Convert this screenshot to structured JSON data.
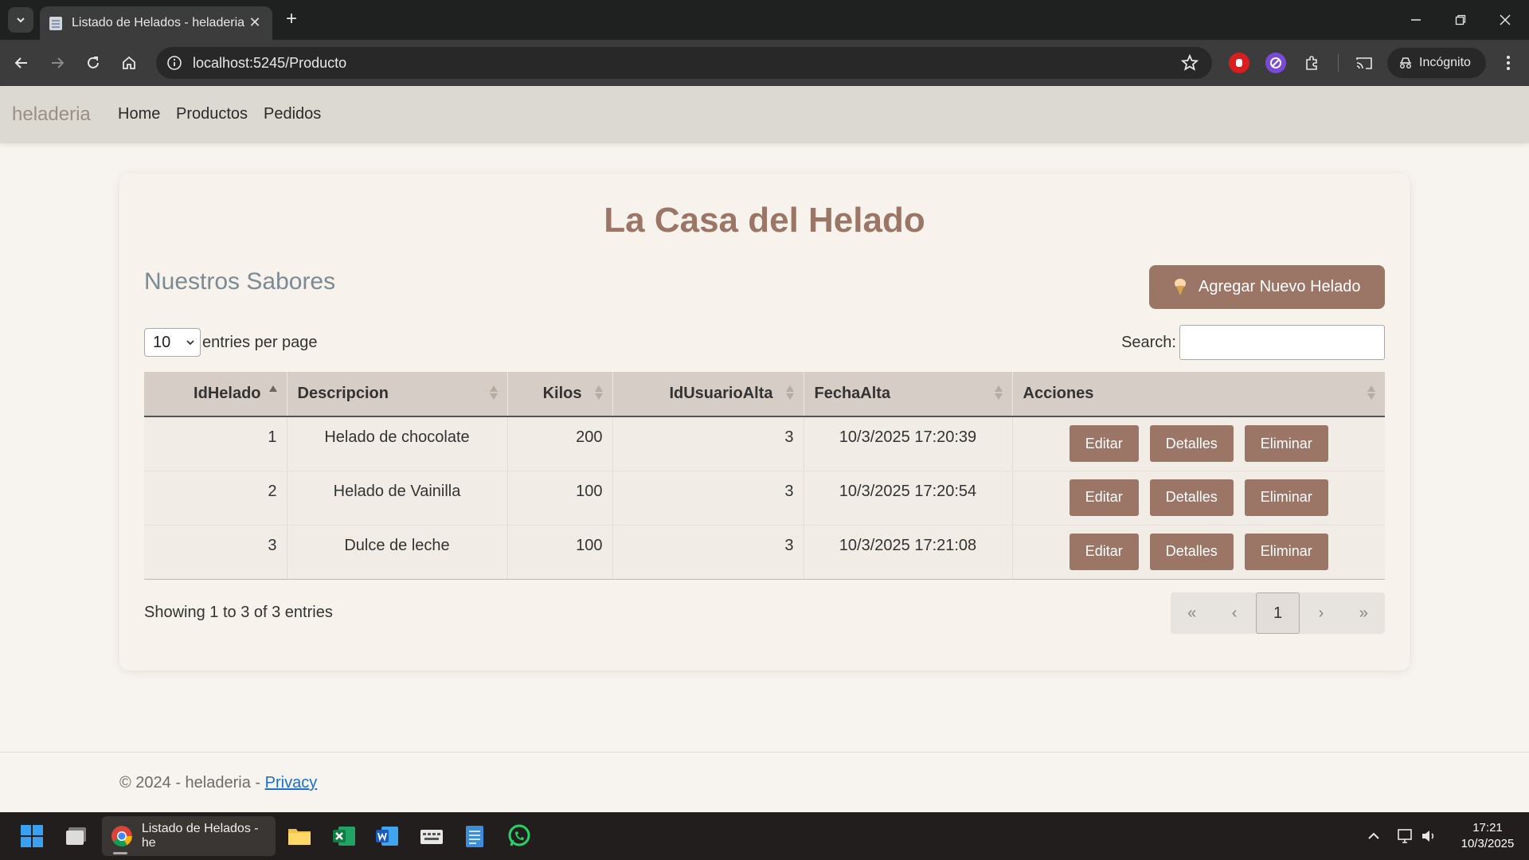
{
  "browser": {
    "tab_title": "Listado de Helados - heladeria",
    "url": "localhost:5245/Producto",
    "incognito_label": "Incógnito"
  },
  "navbar": {
    "brand": "heladeria",
    "links": [
      "Home",
      "Productos",
      "Pedidos"
    ]
  },
  "page": {
    "title": "La Casa del Helado",
    "subtitle": "Nuestros Sabores",
    "add_button": "Agregar Nuevo Helado",
    "per_page_value": "10",
    "per_page_label": "entries per page",
    "search_label": "Search:",
    "search_value": ""
  },
  "table": {
    "columns": [
      "IdHelado",
      "Descripcion",
      "Kilos",
      "IdUsuarioAlta",
      "FechaAlta",
      "Acciones"
    ],
    "rows": [
      {
        "id": "1",
        "desc": "Helado de chocolate",
        "kilos": "200",
        "user": "3",
        "fecha": "10/3/2025 17:20:39"
      },
      {
        "id": "2",
        "desc": "Helado de Vainilla",
        "kilos": "100",
        "user": "3",
        "fecha": "10/3/2025 17:20:54"
      },
      {
        "id": "3",
        "desc": "Dulce de leche",
        "kilos": "100",
        "user": "3",
        "fecha": "10/3/2025 17:21:08"
      }
    ],
    "actions": [
      "Editar",
      "Detalles",
      "Eliminar"
    ]
  },
  "table_info": "Showing 1 to 3 of 3 entries",
  "pagination": [
    "«",
    "‹",
    "1",
    "›",
    "»"
  ],
  "footer": {
    "copyright": "© 2024 - heladeria - ",
    "privacy": "Privacy"
  },
  "taskbar": {
    "active_app": "Listado de Helados - he",
    "time": "17:21",
    "date": "10/3/2025"
  },
  "colors": {
    "accent": "#9b7666",
    "nav_bg": "#dcd8d2",
    "page_bg": "#f7f3ee",
    "header_bg": "#d5cdc6"
  }
}
